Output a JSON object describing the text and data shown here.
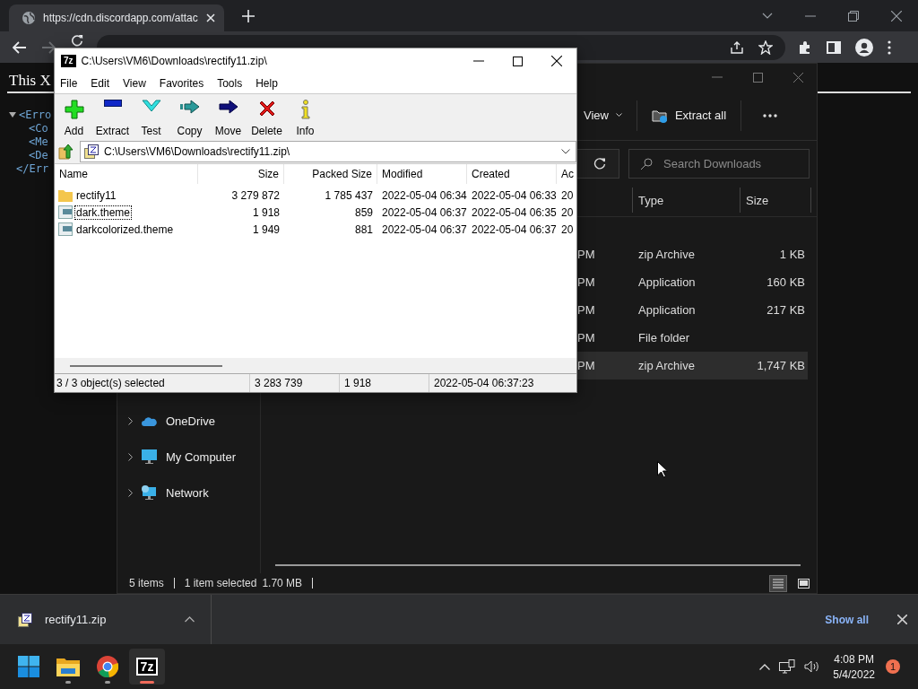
{
  "browser": {
    "tab": {
      "title": "https://cdn.discordapp.com/attac"
    },
    "forward_disabled": true,
    "page": {
      "heading": "This X",
      "xml": [
        {
          "text": "<Erro",
          "closing": "</Err",
          "expanded": true,
          "children": [
            {
              "text": "<Co"
            },
            {
              "text": "<Me"
            },
            {
              "text": "<De"
            }
          ]
        }
      ]
    }
  },
  "explorer": {
    "toolbar": {
      "view": "View",
      "extract_all": "Extract all"
    },
    "search": {
      "placeholder": "Search Downloads"
    },
    "columns": [
      "Type",
      "Size"
    ],
    "rows": [
      {
        "modified": "PM",
        "type": "zip Archive",
        "size": "1 KB",
        "selected": false
      },
      {
        "modified": "PM",
        "type": "Application",
        "size": "160 KB",
        "selected": false
      },
      {
        "modified": "PM",
        "type": "Application",
        "size": "217 KB",
        "selected": false
      },
      {
        "modified": "PM",
        "type": "File folder",
        "size": "",
        "selected": false
      },
      {
        "modified": "PM",
        "type": "zip Archive",
        "size": "1,747 KB",
        "selected": true
      }
    ],
    "nav": [
      {
        "label": "OneDrive",
        "kind": "cloud"
      },
      {
        "label": "My Computer",
        "kind": "computer"
      },
      {
        "label": "Network",
        "kind": "network"
      }
    ],
    "status": {
      "items": "5 items",
      "selection": "1 item selected",
      "size": "1.70 MB"
    },
    "view_buttons": [
      {
        "kind": "details",
        "selected": true
      },
      {
        "kind": "preview",
        "selected": false
      }
    ]
  },
  "archiver": {
    "icon_text": "7z",
    "title": "C:\\Users\\VM6\\Downloads\\rectify11.zip\\",
    "menu": [
      "File",
      "Edit",
      "View",
      "Favorites",
      "Tools",
      "Help"
    ],
    "tools": [
      {
        "label": "Add",
        "kind": "add"
      },
      {
        "label": "Extract",
        "kind": "extract"
      },
      {
        "label": "Test",
        "kind": "test"
      },
      {
        "label": "Copy",
        "kind": "copy"
      },
      {
        "label": "Move",
        "kind": "move"
      },
      {
        "label": "Delete",
        "kind": "delete"
      },
      {
        "label": "Info",
        "kind": "info"
      }
    ],
    "path": "C:\\Users\\VM6\\Downloads\\rectify11.zip\\",
    "columns": [
      "Name",
      "Size",
      "Packed Size",
      "Modified",
      "Created",
      "Ac"
    ],
    "files": [
      {
        "name": "rectify11",
        "kind": "folder",
        "size": "3 279 872",
        "packed": "1 785 437",
        "modified": "2022-05-04 06:34",
        "created": "2022-05-04 06:33",
        "accessed": "20",
        "focused": false
      },
      {
        "name": "dark.theme",
        "kind": "file",
        "size": "1 918",
        "packed": "859",
        "modified": "2022-05-04 06:37",
        "created": "2022-05-04 06:35",
        "accessed": "20",
        "focused": true
      },
      {
        "name": "darkcolorized.theme",
        "kind": "file",
        "size": "1 949",
        "packed": "881",
        "modified": "2022-05-04 06:37",
        "created": "2022-05-04 06:37",
        "accessed": "20",
        "focused": false
      }
    ],
    "status": [
      "3 / 3 object(s) selected",
      "3 283 739",
      "1 918",
      "2022-05-04 06:37:23"
    ]
  },
  "downloads_bar": {
    "file": "rectify11.zip",
    "show_all": "Show all"
  },
  "taskbar": {
    "apps": [
      {
        "kind": "start",
        "active": false,
        "running": false
      },
      {
        "kind": "folder",
        "active": false,
        "running": true
      },
      {
        "kind": "browser",
        "active": false,
        "running": true
      },
      {
        "kind": "archiver",
        "label": "7z",
        "active": true,
        "running": true
      }
    ],
    "time": "4:08 PM",
    "date": "5/4/2022",
    "notifications": "1"
  }
}
